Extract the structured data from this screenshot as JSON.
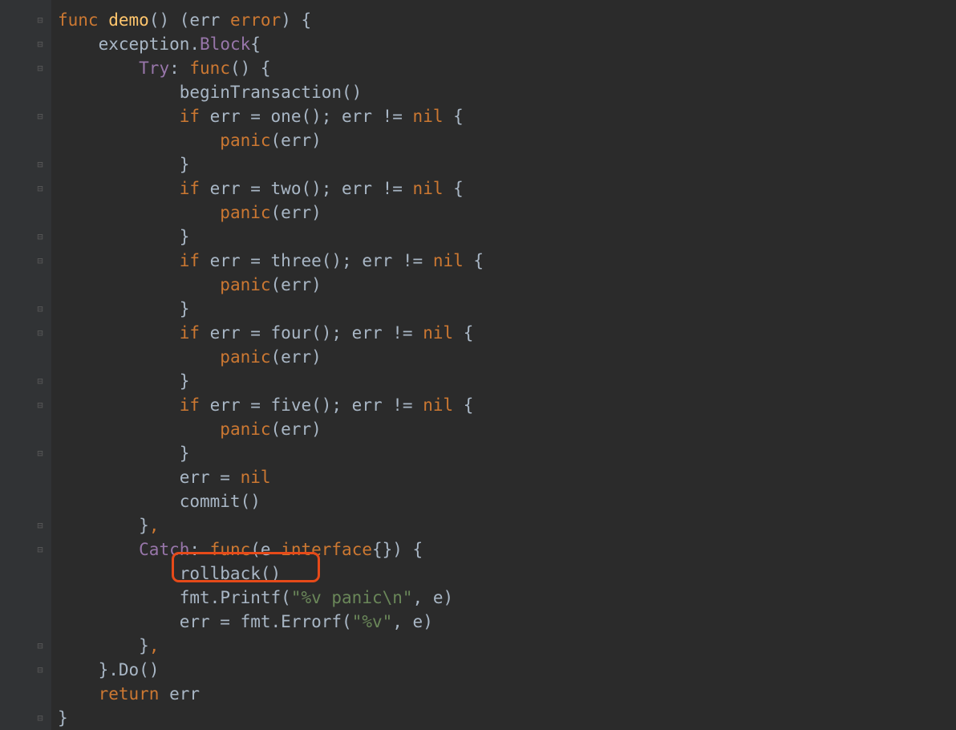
{
  "code": {
    "line1": {
      "func": "func",
      "name": "demo",
      "rest": "() (err ",
      "error": "error",
      "brace": ") {"
    },
    "line2": {
      "indent": "    ",
      "exc": "exception",
      "dot": ".",
      "block": "Block",
      "brace": "{"
    },
    "line3": {
      "indent": "        ",
      "try": "Try",
      "colon": ": ",
      "func": "func",
      "rest": "() {"
    },
    "line4": {
      "indent": "            ",
      "fn": "beginTransaction",
      "rest": "()"
    },
    "line5": {
      "indent": "            ",
      "if": "if",
      "rest": " err = ",
      "fn": "one",
      "rest2": "(); err != ",
      "nil": "nil",
      "brace": " {"
    },
    "line6": {
      "indent": "                ",
      "panic": "panic",
      "rest": "(err)"
    },
    "line7": {
      "indent": "            ",
      "brace": "}"
    },
    "line8": {
      "indent": "            ",
      "if": "if",
      "rest": " err = ",
      "fn": "two",
      "rest2": "(); err != ",
      "nil": "nil",
      "brace": " {"
    },
    "line9": {
      "indent": "                ",
      "panic": "panic",
      "rest": "(err)"
    },
    "line10": {
      "indent": "            ",
      "brace": "}"
    },
    "line11": {
      "indent": "            ",
      "if": "if",
      "rest": " err = ",
      "fn": "three",
      "rest2": "(); err != ",
      "nil": "nil",
      "brace": " {"
    },
    "line12": {
      "indent": "                ",
      "panic": "panic",
      "rest": "(err)"
    },
    "line13": {
      "indent": "            ",
      "brace": "}"
    },
    "line14": {
      "indent": "            ",
      "if": "if",
      "rest": " err = ",
      "fn": "four",
      "rest2": "(); err != ",
      "nil": "nil",
      "brace": " {"
    },
    "line15": {
      "indent": "                ",
      "panic": "panic",
      "rest": "(err)"
    },
    "line16": {
      "indent": "            ",
      "brace": "}"
    },
    "line17": {
      "indent": "            ",
      "if": "if",
      "rest": " err = ",
      "fn": "five",
      "rest2": "(); err != ",
      "nil": "nil",
      "brace": " {"
    },
    "line18": {
      "indent": "                ",
      "panic": "panic",
      "rest": "(err)"
    },
    "line19": {
      "indent": "            ",
      "brace": "}"
    },
    "line20": {
      "indent": "            ",
      "rest": "err = ",
      "nil": "nil"
    },
    "line21": {
      "indent": "            ",
      "fn": "commit",
      "rest": "()"
    },
    "line22": {
      "indent": "        ",
      "brace": "}",
      "comma": ","
    },
    "line23": {
      "indent": "        ",
      "catch": "Catch",
      "colon": ": ",
      "func": "func",
      "rest": "(e ",
      "iface": "interface",
      "rest2": "{}) {"
    },
    "line24": {
      "indent": "            ",
      "fn": "rollback",
      "rest": "()"
    },
    "line25": {
      "indent": "            ",
      "pkg": "fmt",
      "dot": ".",
      "fn": "Printf",
      "paren": "(",
      "str": "\"%v panic\\n\"",
      "rest": ", e)"
    },
    "line26": {
      "indent": "            ",
      "rest": "err = ",
      "pkg": "fmt",
      "dot": ".",
      "fn": "Errorf",
      "paren": "(",
      "str": "\"%v\"",
      "rest2": ", e)"
    },
    "line27": {
      "indent": "        ",
      "brace": "}",
      "comma": ","
    },
    "line28": {
      "indent": "    ",
      "brace": "}.",
      "fn": "Do",
      "rest": "()"
    },
    "line29": {
      "indent": "    ",
      "return": "return",
      "rest": " err"
    },
    "line30": {
      "brace": "}"
    }
  },
  "highlight": {
    "target": "rollback()"
  }
}
